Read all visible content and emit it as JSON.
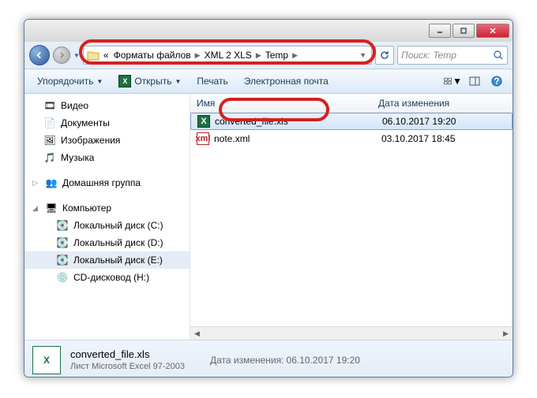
{
  "titlebar": {},
  "nav": {
    "crumbs_prefix": "«",
    "crumb1": "Форматы файлов",
    "crumb2": "XML 2 XLS",
    "crumb3": "Temp",
    "search_placeholder": "Поиск: Temp"
  },
  "toolbar": {
    "organize": "Упорядочить",
    "open": "Открыть",
    "print": "Печать",
    "email": "Электронная почта"
  },
  "sidebar": {
    "items": [
      {
        "label": "Видео"
      },
      {
        "label": "Документы"
      },
      {
        "label": "Изображения"
      },
      {
        "label": "Музыка"
      }
    ],
    "homegroup": "Домашняя группа",
    "computer": "Компьютер",
    "drives": [
      {
        "label": "Локальный диск (C:)"
      },
      {
        "label": "Локальный диск (D:)"
      },
      {
        "label": "Локальный диск (E:)"
      },
      {
        "label": "CD-дисковод (H:)"
      }
    ]
  },
  "columns": {
    "name": "Имя",
    "modified": "Дата изменения"
  },
  "files": [
    {
      "name": "converted_file.xls",
      "date": "06.10.2017 19:20",
      "type": "xls"
    },
    {
      "name": "note.xml",
      "date": "03.10.2017 18:45",
      "type": "xml"
    }
  ],
  "details": {
    "name": "converted_file.xls",
    "type": "Лист Microsoft Excel 97-2003",
    "modified_label": "Дата изменения:",
    "modified_value": "06.10.2017 19:20"
  }
}
